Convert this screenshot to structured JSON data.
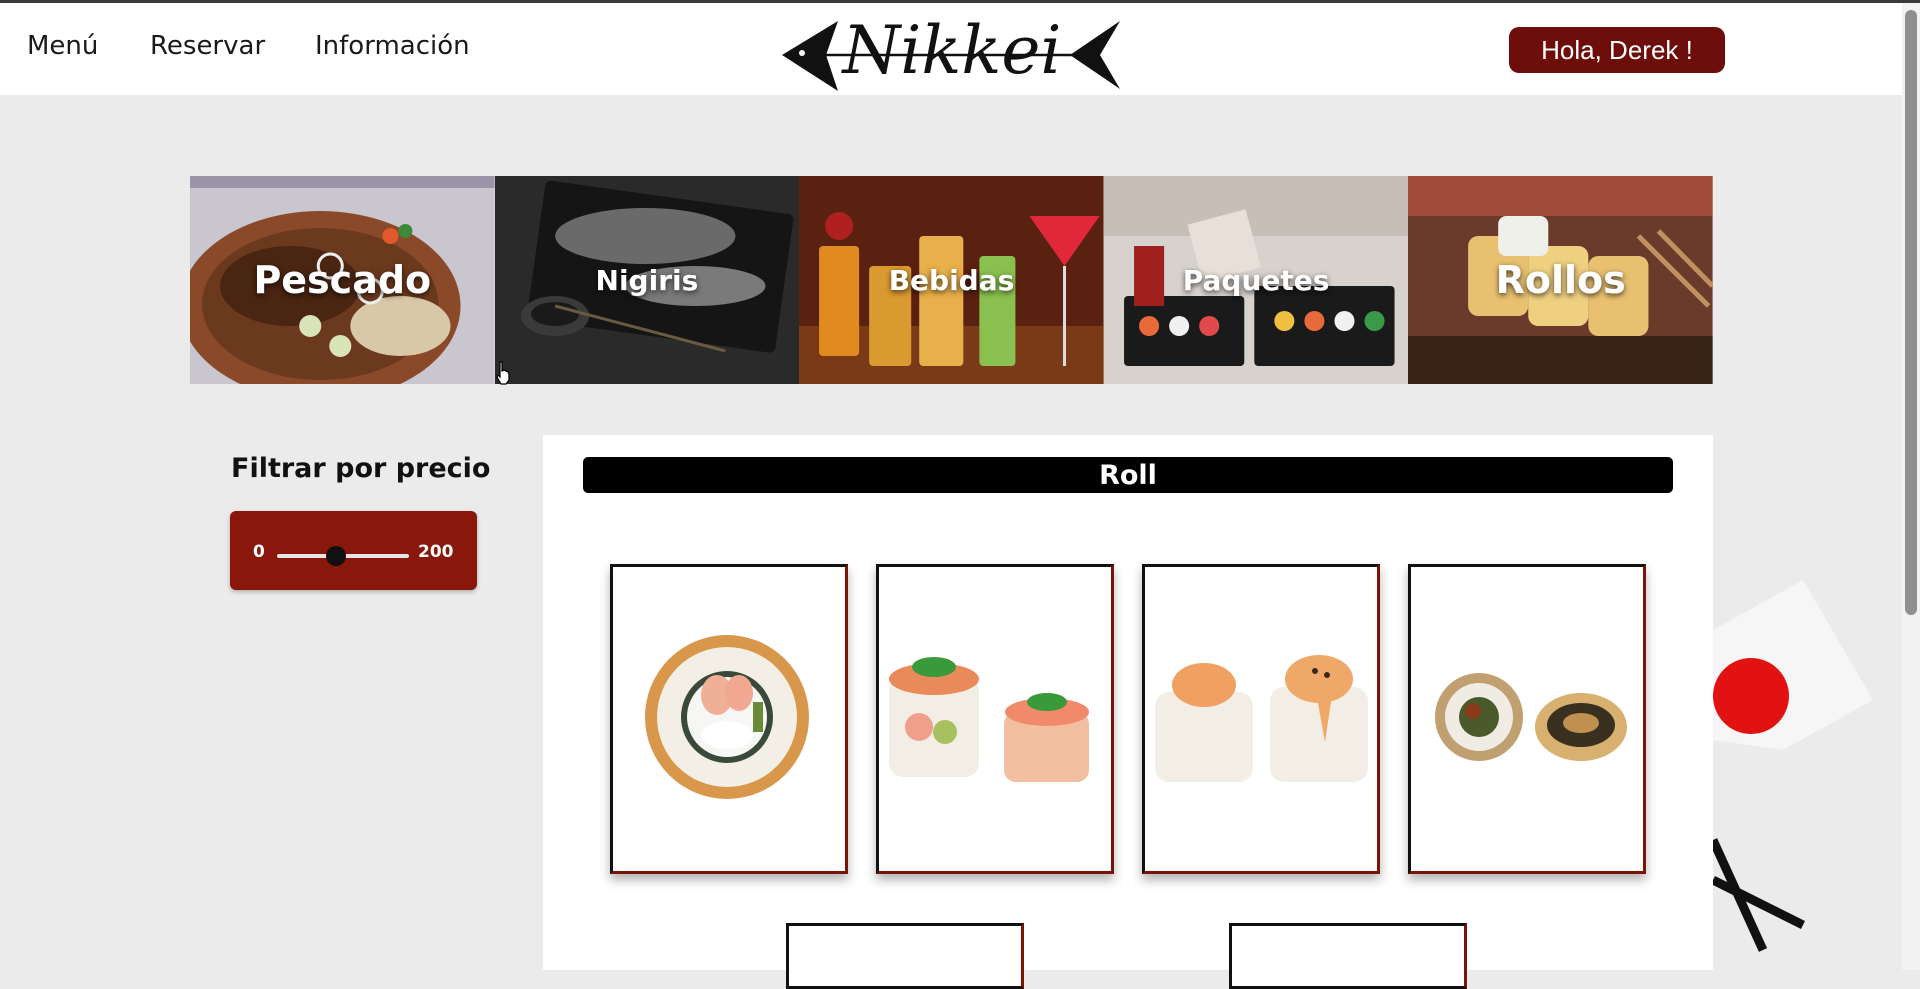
{
  "nav": {
    "links": [
      "Menú",
      "Reservar",
      "Información"
    ],
    "logo_text": "Nikkei",
    "greeting": "Hola, Derek !"
  },
  "categories": [
    {
      "label": "Pescado"
    },
    {
      "label": "Nigiris"
    },
    {
      "label": "Bebidas"
    },
    {
      "label": "Paquetes"
    },
    {
      "label": "Rollos"
    }
  ],
  "filter": {
    "title": "Filtrar por precio",
    "min_label": "0",
    "max_label": "200",
    "slider_level": 0.45
  },
  "section": {
    "title": "Roll"
  },
  "products": [
    {
      "icon": "california-roll-image"
    },
    {
      "icon": "acevichado-roll-image"
    },
    {
      "icon": "spicy-roll-image"
    },
    {
      "icon": "tempura-roll-image"
    }
  ],
  "colors": {
    "accent": "#8a170c",
    "greeting_bg": "#6e0e0a",
    "page_bg": "#ebebeb"
  }
}
